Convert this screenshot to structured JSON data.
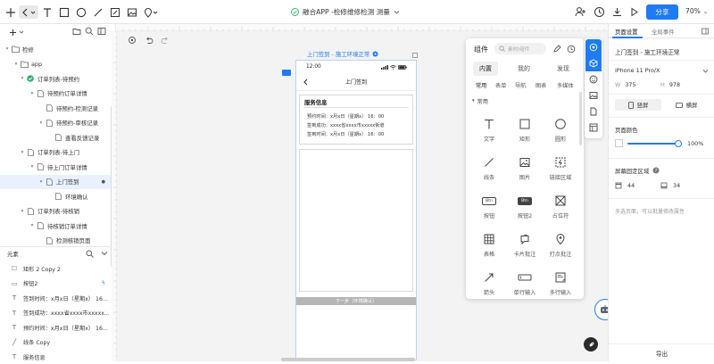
{
  "toolbar": {
    "title": "融合APP -检修维修检测 测量",
    "share_label": "分享",
    "zoom": "70%"
  },
  "layers": {
    "items": [
      {
        "label": "检修",
        "level": 0,
        "kind": "folder",
        "expanded": true
      },
      {
        "label": "app",
        "level": 1,
        "kind": "folder",
        "expanded": true
      },
      {
        "label": "订单列表-待预约",
        "level": 2,
        "kind": "check",
        "expanded": true
      },
      {
        "label": "待预约订单详情",
        "level": 3,
        "kind": "page",
        "expanded": true
      },
      {
        "label": "待预约-检测记录",
        "level": 4,
        "kind": "page",
        "expanded": false
      },
      {
        "label": "待预约-审核记录",
        "level": 4,
        "kind": "page",
        "expanded": true
      },
      {
        "label": "查看反馈记录",
        "level": 5,
        "kind": "page",
        "expanded": false
      },
      {
        "label": "订单列表-待上门",
        "level": 2,
        "kind": "page",
        "expanded": true
      },
      {
        "label": "待上门订单详情",
        "level": 3,
        "kind": "page",
        "expanded": true
      },
      {
        "label": "上门签到",
        "level": 4,
        "kind": "page",
        "expanded": true,
        "active": true
      },
      {
        "label": "环境确认",
        "level": 5,
        "kind": "page",
        "expanded": false
      },
      {
        "label": "订单列表-待核销",
        "level": 2,
        "kind": "page",
        "expanded": true
      },
      {
        "label": "待核销订单详情",
        "level": 3,
        "kind": "page",
        "expanded": true
      },
      {
        "label": "检测核销页面",
        "level": 4,
        "kind": "page",
        "expanded": false
      }
    ]
  },
  "elements": {
    "title": "元素",
    "items": [
      {
        "icon": "rect",
        "label": "矩形 2 Copy 2"
      },
      {
        "icon": "button",
        "label": "按钮2",
        "lightning": true
      },
      {
        "icon": "text",
        "label": "签到时间：x月x日（星期x） 16..."
      },
      {
        "icon": "text",
        "label": "签到成功：xxxx省xxxx市xxxxx..."
      },
      {
        "icon": "text",
        "label": "预约时间：x月x日（星期x） 16..."
      },
      {
        "icon": "line",
        "label": "线条 Copy"
      },
      {
        "icon": "text",
        "label": "服务信息"
      }
    ]
  },
  "canvas": {
    "frame_label": "上门签到 - 施工环境正常",
    "phone": {
      "time": "12:00",
      "nav_title": "上门签到",
      "card_title": "服务信息",
      "lines": [
        "预约时间：x月x日（星期x） 16：00",
        "签到成功：xxxx省xxxx市xxxxx街道",
        "签到时间：x月x日（星期x） 16：00"
      ],
      "button": "下一步（环境确认）"
    }
  },
  "components": {
    "title": "组件",
    "search_placeholder": "素材/组件",
    "tabs": [
      "内置",
      "我的",
      "发现"
    ],
    "subtabs": [
      "常用",
      "表单",
      "导航",
      "图表",
      "多媒体"
    ],
    "section": "常用",
    "items": [
      "文字",
      "矩形",
      "圆形",
      "线条",
      "图片",
      "链接区域",
      "按钮",
      "按钮2",
      "占位符",
      "表格",
      "卡片批注",
      "打点批注",
      "箭头",
      "单行输入",
      "多行输入"
    ],
    "btn_text": "Btn"
  },
  "rightpanel": {
    "tab_page": "页面设置",
    "tab_events": "全局事件",
    "page_name": "上门签到 - 施工环境正常",
    "device": "iPhone 11 Pro/X",
    "w_label": "W",
    "w_value": "375",
    "h_label": "H",
    "h_value": "978",
    "portrait": "竖屏",
    "landscape": "横屏",
    "bg_title": "页面颜色",
    "bg_percent": "100%",
    "fixed_title": "屏幕固定区域",
    "fixed_top": "44",
    "fixed_bottom": "34",
    "hint": "多选页面，可以批量修改属性",
    "export": "导出"
  },
  "colors": {
    "accent": "#1f7bf3",
    "success": "#33b36b",
    "selection": "#e9f1fe"
  }
}
